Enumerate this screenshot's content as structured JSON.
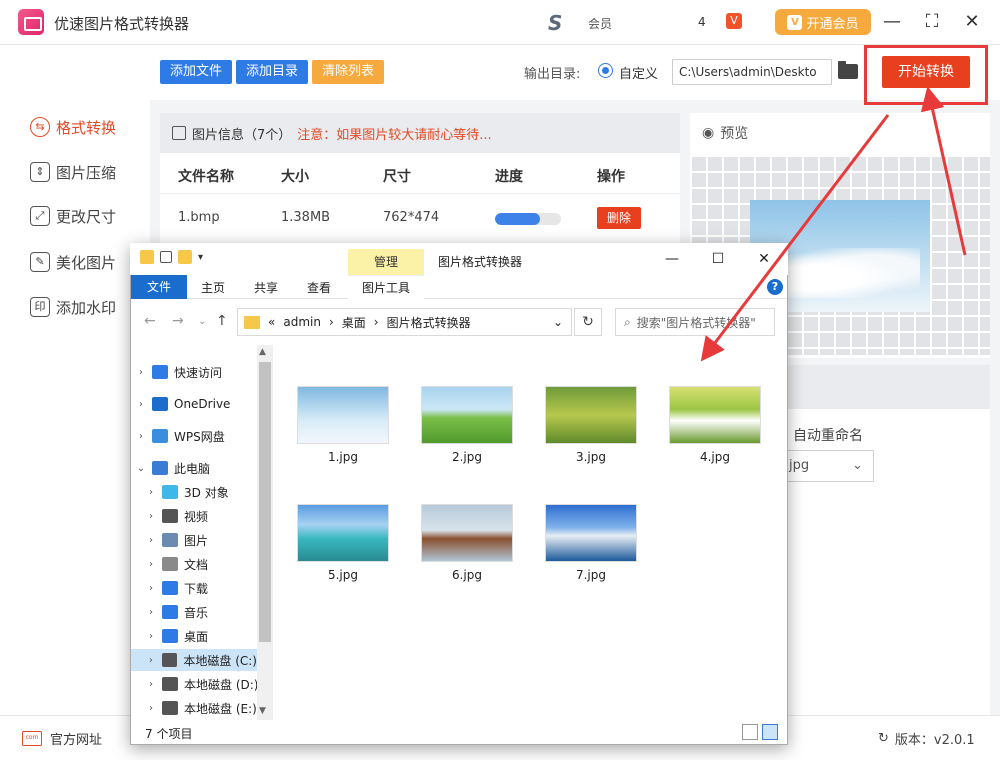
{
  "app": {
    "title": "优速图片格式转换器",
    "vip_label": "会员",
    "vip_num": "4",
    "open_vip": "开通会员",
    "minimize": "—",
    "maximize": "⛶",
    "close": "✕"
  },
  "sidebar": {
    "items": [
      {
        "label": "格式转换",
        "icon": "format-convert-icon"
      },
      {
        "label": "图片压缩",
        "icon": "compress-icon"
      },
      {
        "label": "更改尺寸",
        "icon": "resize-icon"
      },
      {
        "label": "美化图片",
        "icon": "beautify-icon"
      },
      {
        "label": "添加水印",
        "icon": "watermark-icon"
      }
    ]
  },
  "toolbar": {
    "add_file": "添加文件",
    "add_dir": "添加目录",
    "clear_list": "清除列表",
    "output_label": "输出目录:",
    "custom_label": "自定义",
    "path": "C:\\Users\\admin\\Deskto",
    "start": "开始转换"
  },
  "file_panel": {
    "header_title": "图片信息（7个）",
    "notice": "注意：如果图片较大请耐心等待...",
    "columns": [
      "文件名称",
      "大小",
      "尺寸",
      "进度",
      "操作"
    ],
    "rows": [
      {
        "name": "1.bmp",
        "size": "1.38MB",
        "dims": "762*474",
        "progress": 0.68,
        "action": "删除"
      }
    ]
  },
  "preview": {
    "title": "预览"
  },
  "settings": {
    "rename_label": "自动重命名",
    "format_value": "jpg"
  },
  "footer": {
    "site": "官方网址",
    "version": "版本：v2.0.1"
  },
  "explorer": {
    "manage": "管理",
    "title": "图片格式转换器",
    "minimize": "—",
    "maximize": "☐",
    "close": "✕",
    "tabs": {
      "file": "文件",
      "home": "主页",
      "share": "共享",
      "view": "查看",
      "pic_tools": "图片工具"
    },
    "address": [
      "«",
      "admin",
      "›",
      "桌面",
      "›",
      "图片格式转换器"
    ],
    "search_placeholder": "搜索\"图片格式转换器\"",
    "nav": [
      {
        "label": "快速访问",
        "color": "#2f7be5"
      },
      {
        "label": "OneDrive",
        "color": "#1a6dcc"
      },
      {
        "label": "WPS网盘",
        "color": "#3a8ee0"
      },
      {
        "label": "此电脑",
        "color": "#3a7bd5"
      },
      {
        "label": "3D 对象",
        "color": "#3fb8e8"
      },
      {
        "label": "视频",
        "color": "#555555"
      },
      {
        "label": "图片",
        "color": "#6b8bb0"
      },
      {
        "label": "文档",
        "color": "#8a8a8a"
      },
      {
        "label": "下载",
        "color": "#2f7be5"
      },
      {
        "label": "音乐",
        "color": "#2f7be5"
      },
      {
        "label": "桌面",
        "color": "#2f7be5"
      },
      {
        "label": "本地磁盘 (C:)",
        "color": "#555555"
      },
      {
        "label": "本地磁盘 (D:)",
        "color": "#555555"
      },
      {
        "label": "本地磁盘 (E:)",
        "color": "#555555"
      }
    ],
    "files": [
      {
        "name": "1.jpg",
        "bg": "linear-gradient(180deg,#7fb8e0,#d8ecf8 60%,#f2f7fb)"
      },
      {
        "name": "2.jpg",
        "bg": "linear-gradient(180deg,#a8d4ee 0,#cde8f6 40%,#7cbf4a 55%,#4f9a2c 100%)"
      },
      {
        "name": "3.jpg",
        "bg": "linear-gradient(180deg,#6f9a3a,#b7c84d 50%,#5f8a2c)"
      },
      {
        "name": "4.jpg",
        "bg": "linear-gradient(180deg,#d6e070 0,#9cc545 40%,#ffffff 60%,#6a9a30 100%)"
      },
      {
        "name": "5.jpg",
        "bg": "linear-gradient(180deg,#5c9be0 0,#a6d2f2 35%,#38b8c0 60%,#2a8a90 100%)"
      },
      {
        "name": "6.jpg",
        "bg": "linear-gradient(180deg,#b8cad8 0,#d8e4ec 45%,#8a5030 60%,#b0c4d4 100%)"
      },
      {
        "name": "7.jpg",
        "bg": "linear-gradient(180deg,#2f6fd0 0,#7fb2ea 40%,#e8eef4 55%,#1c5a9a 100%)"
      }
    ],
    "status": "7 个项目"
  }
}
